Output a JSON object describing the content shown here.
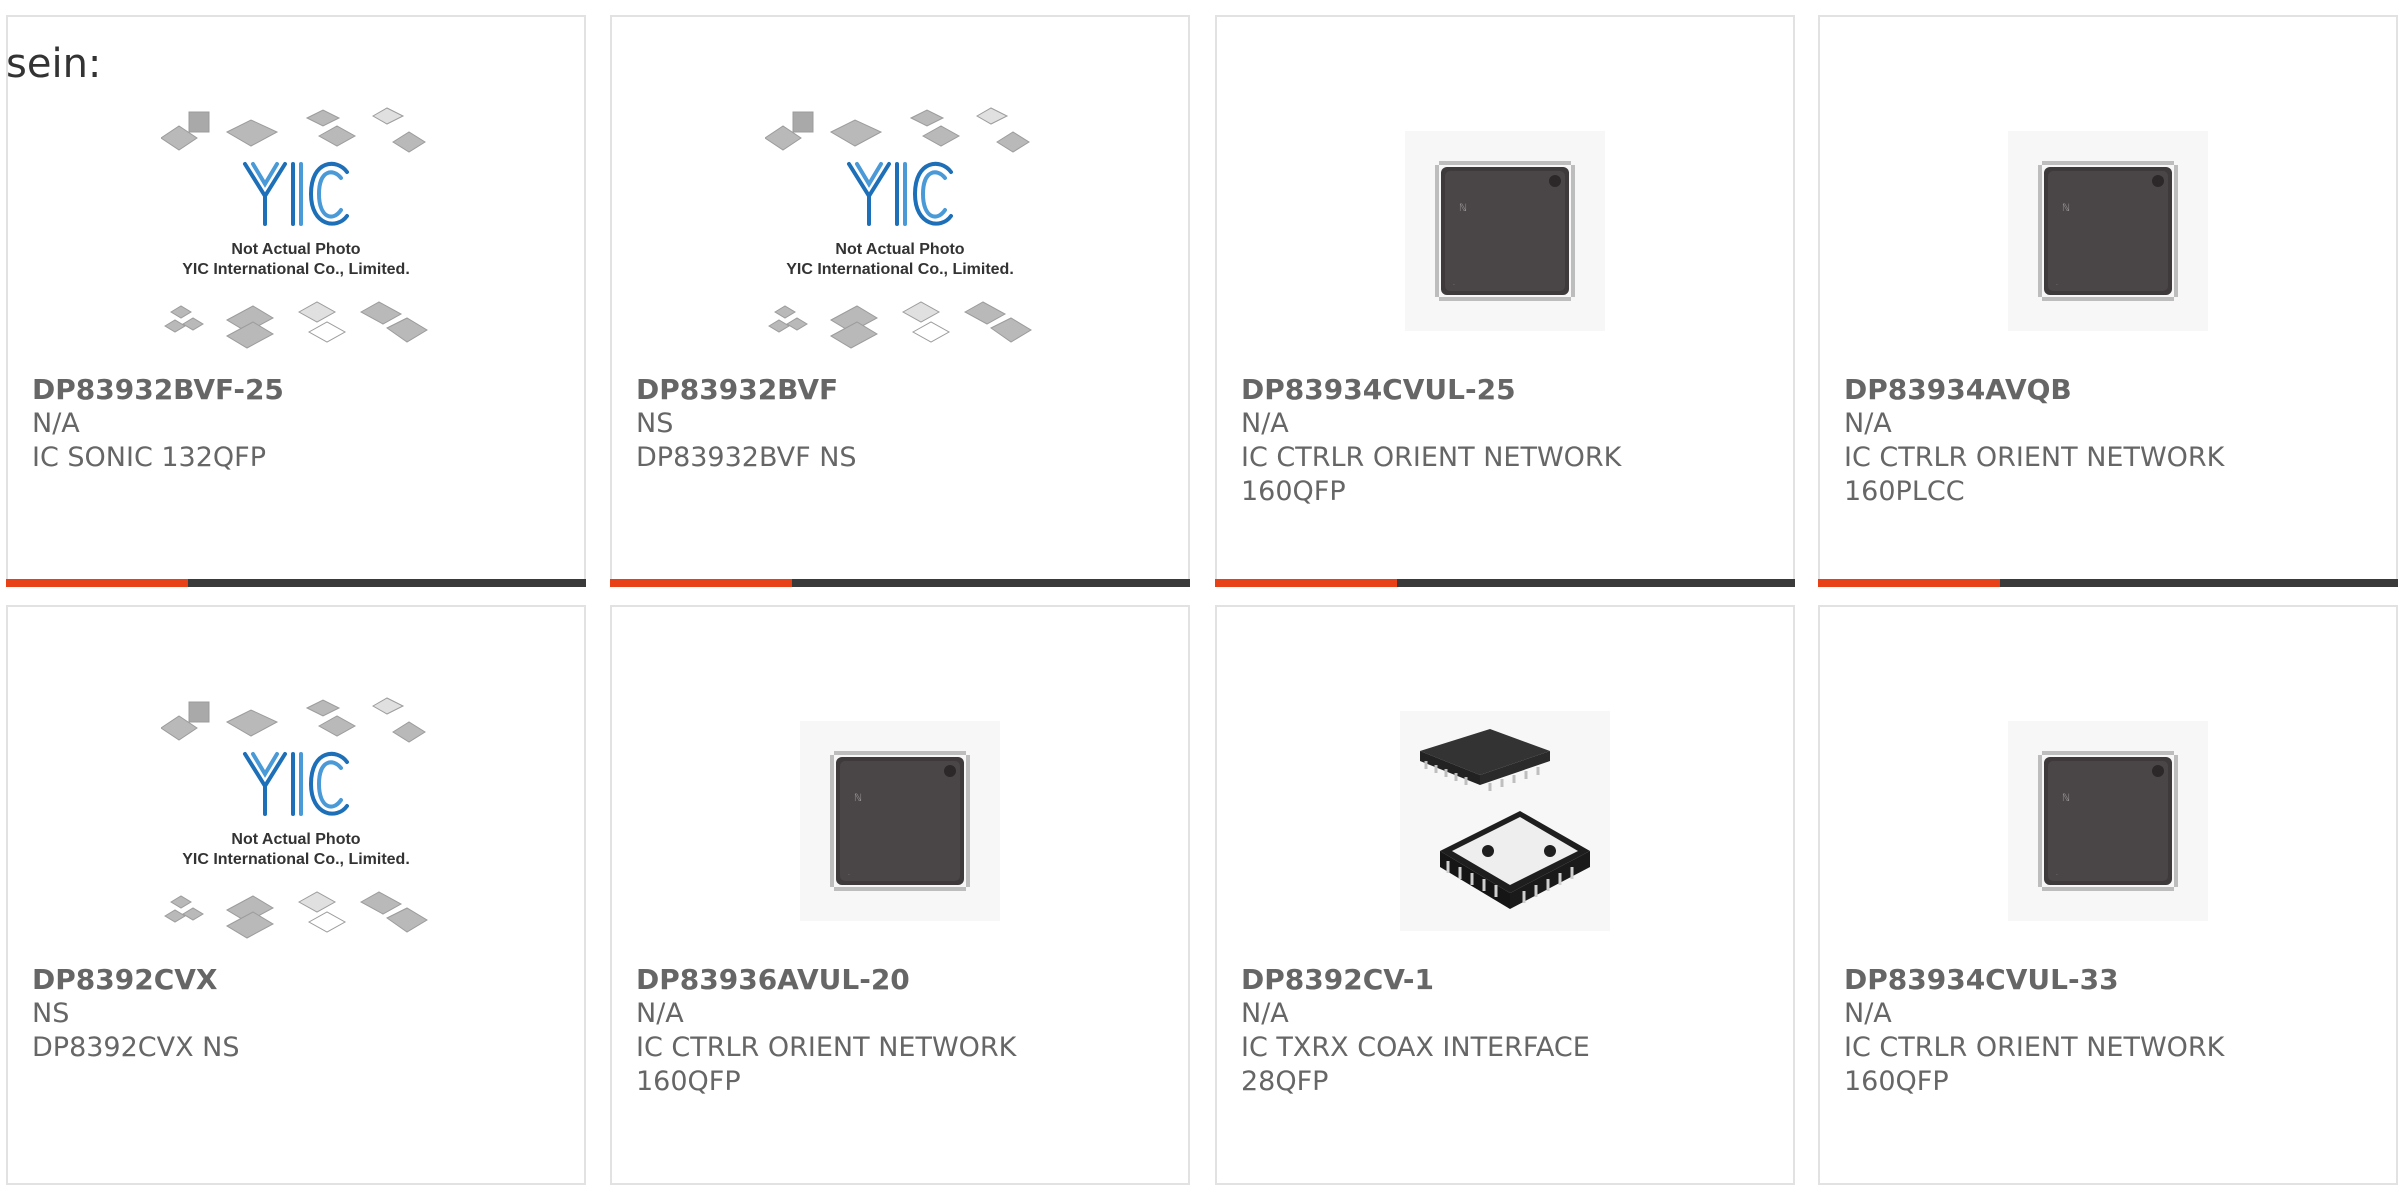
{
  "intro_text": "sein:",
  "placeholder_caption": {
    "line1": "Not Actual Photo",
    "line2": "YIC International Co., Limited."
  },
  "colors": {
    "accent": "#e84017",
    "bar": "#3a3a3a",
    "border": "#e2e2e2",
    "text": "#666666",
    "logo_blue": "#1d6fb8"
  },
  "products": [
    {
      "part_number": "DP83932BVF-25",
      "manufacturer": "N/A",
      "description": "IC SONIC 132QFP",
      "image": "placeholder-logo-icon"
    },
    {
      "part_number": "DP83932BVF",
      "manufacturer": "NS",
      "description": "DP83932BVF NS",
      "image": "placeholder-logo-icon"
    },
    {
      "part_number": "DP83934CVUL-25",
      "manufacturer": "N/A",
      "description": "IC CTRLR ORIENT NETWORK 160QFP",
      "image": "qfp-chip-icon"
    },
    {
      "part_number": "DP83934AVQB",
      "manufacturer": "N/A",
      "description": "IC CTRLR ORIENT NETWORK 160PLCC",
      "image": "qfp-chip-icon"
    },
    {
      "part_number": "DP8392CVX",
      "manufacturer": "NS",
      "description": "DP8392CVX NS",
      "image": "placeholder-logo-icon"
    },
    {
      "part_number": "DP83936AVUL-20",
      "manufacturer": "N/A",
      "description": "IC CTRLR ORIENT NETWORK 160QFP",
      "image": "qfp-chip-icon"
    },
    {
      "part_number": "DP8392CV-1",
      "manufacturer": "N/A",
      "description": "IC TXRX COAX INTERFACE 28QFP",
      "image": "plcc-chip-icon"
    },
    {
      "part_number": "DP83934CVUL-33",
      "manufacturer": "N/A",
      "description": "IC CTRLR ORIENT NETWORK 160QFP",
      "image": "qfp-chip-icon"
    }
  ]
}
